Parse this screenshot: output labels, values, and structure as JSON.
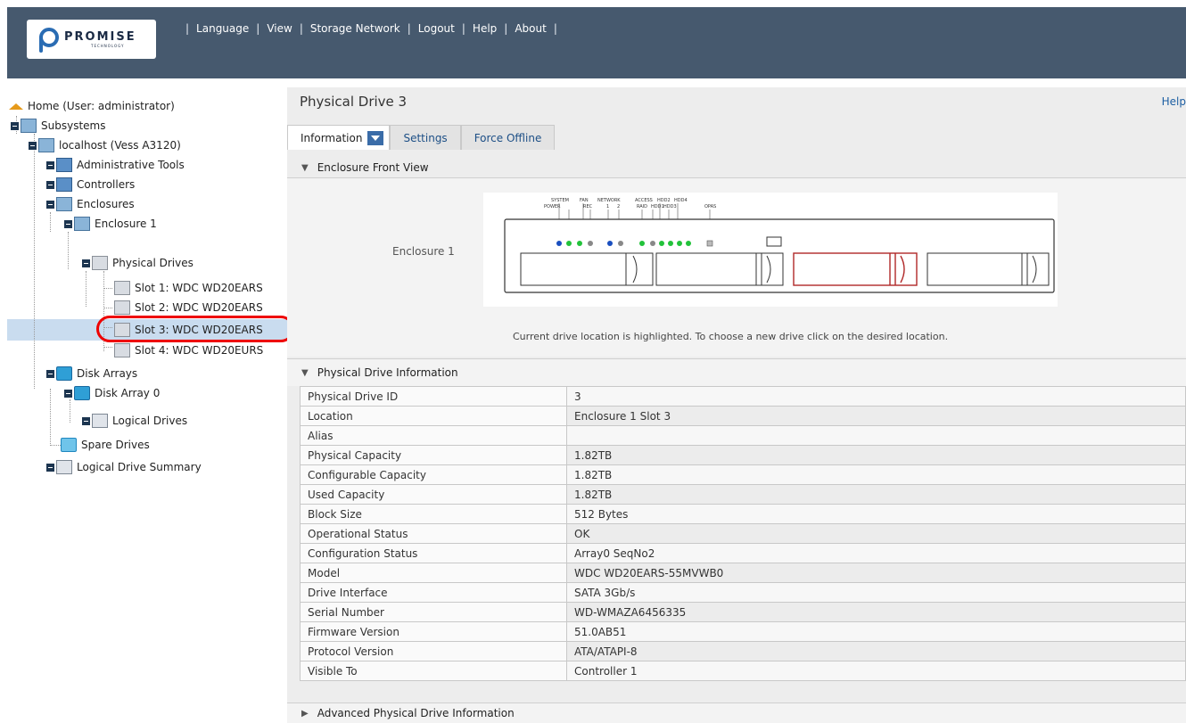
{
  "header": {
    "logo_text": "PROMISE",
    "logo_subtext": "TECHNOLOGY",
    "nav": [
      "Language",
      "View",
      "Storage Network",
      "Logout",
      "Help",
      "About"
    ]
  },
  "tree": {
    "items": [
      {
        "label": "Home (User: administrator)"
      },
      {
        "label": "Subsystems"
      },
      {
        "label": "localhost (Vess A3120)"
      },
      {
        "label": "Administrative Tools"
      },
      {
        "label": "Controllers"
      },
      {
        "label": "Enclosures"
      },
      {
        "label": "Enclosure 1"
      },
      {
        "label": "Physical Drives"
      },
      {
        "label": "Slot 1: WDC WD20EARS"
      },
      {
        "label": "Slot 2: WDC WD20EARS"
      },
      {
        "label": "Slot 3: WDC WD20EARS"
      },
      {
        "label": "Slot 4: WDC WD20EURS"
      },
      {
        "label": "Disk Arrays"
      },
      {
        "label": "Disk Array 0"
      },
      {
        "label": "Logical Drives"
      },
      {
        "label": "Spare Drives"
      },
      {
        "label": "Logical Drive Summary"
      }
    ]
  },
  "main": {
    "title": "Physical Drive 3",
    "help": "Help",
    "tabs": [
      "Information",
      "Settings",
      "Force Offline"
    ],
    "front_view": {
      "heading": "Enclosure Front View",
      "enclosure_label": "Enclosure 1",
      "panel_labels": [
        "SYSTEM",
        "POWER",
        "FAN",
        "REC",
        "NETWORK",
        "1",
        "2",
        "ACCESS",
        "RAID",
        "HDD2",
        "HDD1",
        "HDD3",
        "HDD4",
        "OPAS"
      ],
      "note": "Current drive location is highlighted. To choose a new drive click on the desired location."
    },
    "info": {
      "heading": "Physical Drive Information",
      "rows": [
        {
          "k": "Physical Drive ID",
          "v": "3"
        },
        {
          "k": "Location",
          "v": "Enclosure 1 Slot 3"
        },
        {
          "k": "Alias",
          "v": ""
        },
        {
          "k": "Physical Capacity",
          "v": "1.82TB"
        },
        {
          "k": "Configurable Capacity",
          "v": "1.82TB"
        },
        {
          "k": "Used Capacity",
          "v": "1.82TB"
        },
        {
          "k": "Block Size",
          "v": "512 Bytes"
        },
        {
          "k": "Operational Status",
          "v": "OK"
        },
        {
          "k": "Configuration Status",
          "v": "Array0 SeqNo2"
        },
        {
          "k": "Model",
          "v": "WDC WD20EARS-55MVWB0"
        },
        {
          "k": "Drive Interface",
          "v": "SATA 3Gb/s"
        },
        {
          "k": "Serial Number",
          "v": "WD-WMAZA6456335"
        },
        {
          "k": "Firmware Version",
          "v": "51.0AB51"
        },
        {
          "k": "Protocol Version",
          "v": "ATA/ATAPI-8"
        },
        {
          "k": "Visible To",
          "v": "Controller 1"
        }
      ]
    },
    "advanced_heading": "Advanced Physical Drive Information"
  },
  "colors": {
    "topbar": "#46596e",
    "link": "#1d5fa3",
    "selection": "#c9dcef",
    "highlight_drive": "#b02828",
    "callout": "#e00000"
  }
}
